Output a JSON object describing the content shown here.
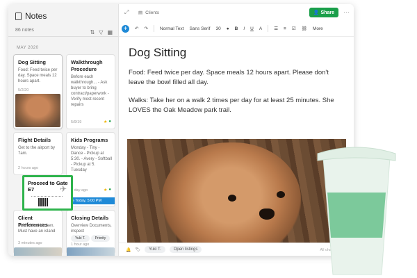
{
  "sidebar": {
    "title": "Notes",
    "count": "86 notes",
    "month": "MAY 2020",
    "cards": [
      {
        "title": "Dog Sitting",
        "body": "Food: Feed twice per day. Space meals 12 hours apart.",
        "date": "5/2/20"
      },
      {
        "title": "Walkthrough Procedure",
        "body": "Before each walkthrough... - Ask buyer to bring contract/paperwork - Verify most recent repairs",
        "date": "5/9/19"
      },
      {
        "title": "Flight Details",
        "body": "Get to the airport by 7am.",
        "date": "2 hours ago"
      },
      {
        "title": "Kids Programs",
        "body": "Monday - Tiny - Dance - Pickup at 5:30. - Avery - Softball - Pickup at 5. Tuesday",
        "date": "1 day ago",
        "reminder": "Today, 5:00 PM"
      },
      {
        "title": "Client Preferences",
        "body": "Yuki's ideal kitchen. Must have an island",
        "date": "3 minutes ago"
      },
      {
        "title": "Closing Details",
        "body": "Overview Documents, inspect",
        "date": "1 hour ago",
        "tags": [
          "Yuki T.",
          "Priority"
        ]
      }
    ],
    "green_note": {
      "title": "Proceed to Gate E7"
    }
  },
  "main": {
    "breadcrumb": "Clients",
    "share_label": "Share",
    "toolbar": {
      "style": "Normal Text",
      "font": "Sans Serif",
      "size": "30",
      "more": "More"
    },
    "note": {
      "title": "Dog Sitting",
      "p1": "Food: Feed twice per day. Space meals 12 hours apart. Please don't leave the bowl filled all day.",
      "p2": "Walks: Take her on a walk 2 times per day for at least 25 minutes. She LOVES the Oak Meadow park trail."
    },
    "bottombar": {
      "user": "Yuki T.",
      "listings": "Open listings",
      "status": "All changes saved"
    }
  },
  "colors": {
    "accent": "#1f8ad7",
    "share": "#1a9f4a",
    "highlight": "#2db34b",
    "cup": "#7cc99b"
  }
}
